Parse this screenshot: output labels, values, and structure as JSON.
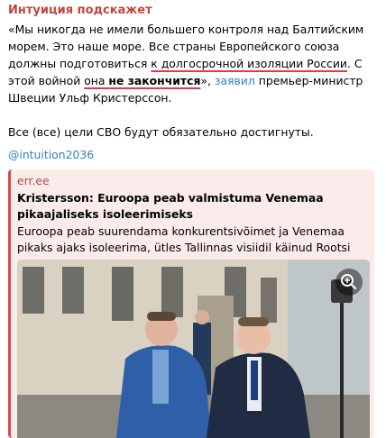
{
  "message": {
    "sender": "Интуиция подскажет",
    "text": {
      "p1_a": "«Мы никогда не имели большего контроля над Балтийским морем. Это наше море. Все страны Европейского союза должны подготовиться ",
      "p1_u1": "к долгосрочной изоляции России",
      "p1_b": ". С этой войной ",
      "p1_u2a": "она ",
      "p1_u2b": "не закончится",
      "p1_c": "», ",
      "p1_link": "заявил",
      "p1_d": " премьер-министр Швеции Ульф Кристерссон.",
      "p2": "Все (все) цели СВО будут обязательно достигнуты."
    },
    "mention": "@intuition2036"
  },
  "preview": {
    "site": "err.ee",
    "title": "Kristersson: Euroopa peab valmistuma Venemaa pikaajaliseks isoleerimiseks",
    "description": "Euroopa peab suurendama konkurentsivõimet ja Venemaa pikaks ajaks isoleerima, ütles Tallinnas visiidil käinud Rootsi pea…",
    "accent_color": "#d8494c",
    "image_icon": "zoom-in-icon"
  }
}
